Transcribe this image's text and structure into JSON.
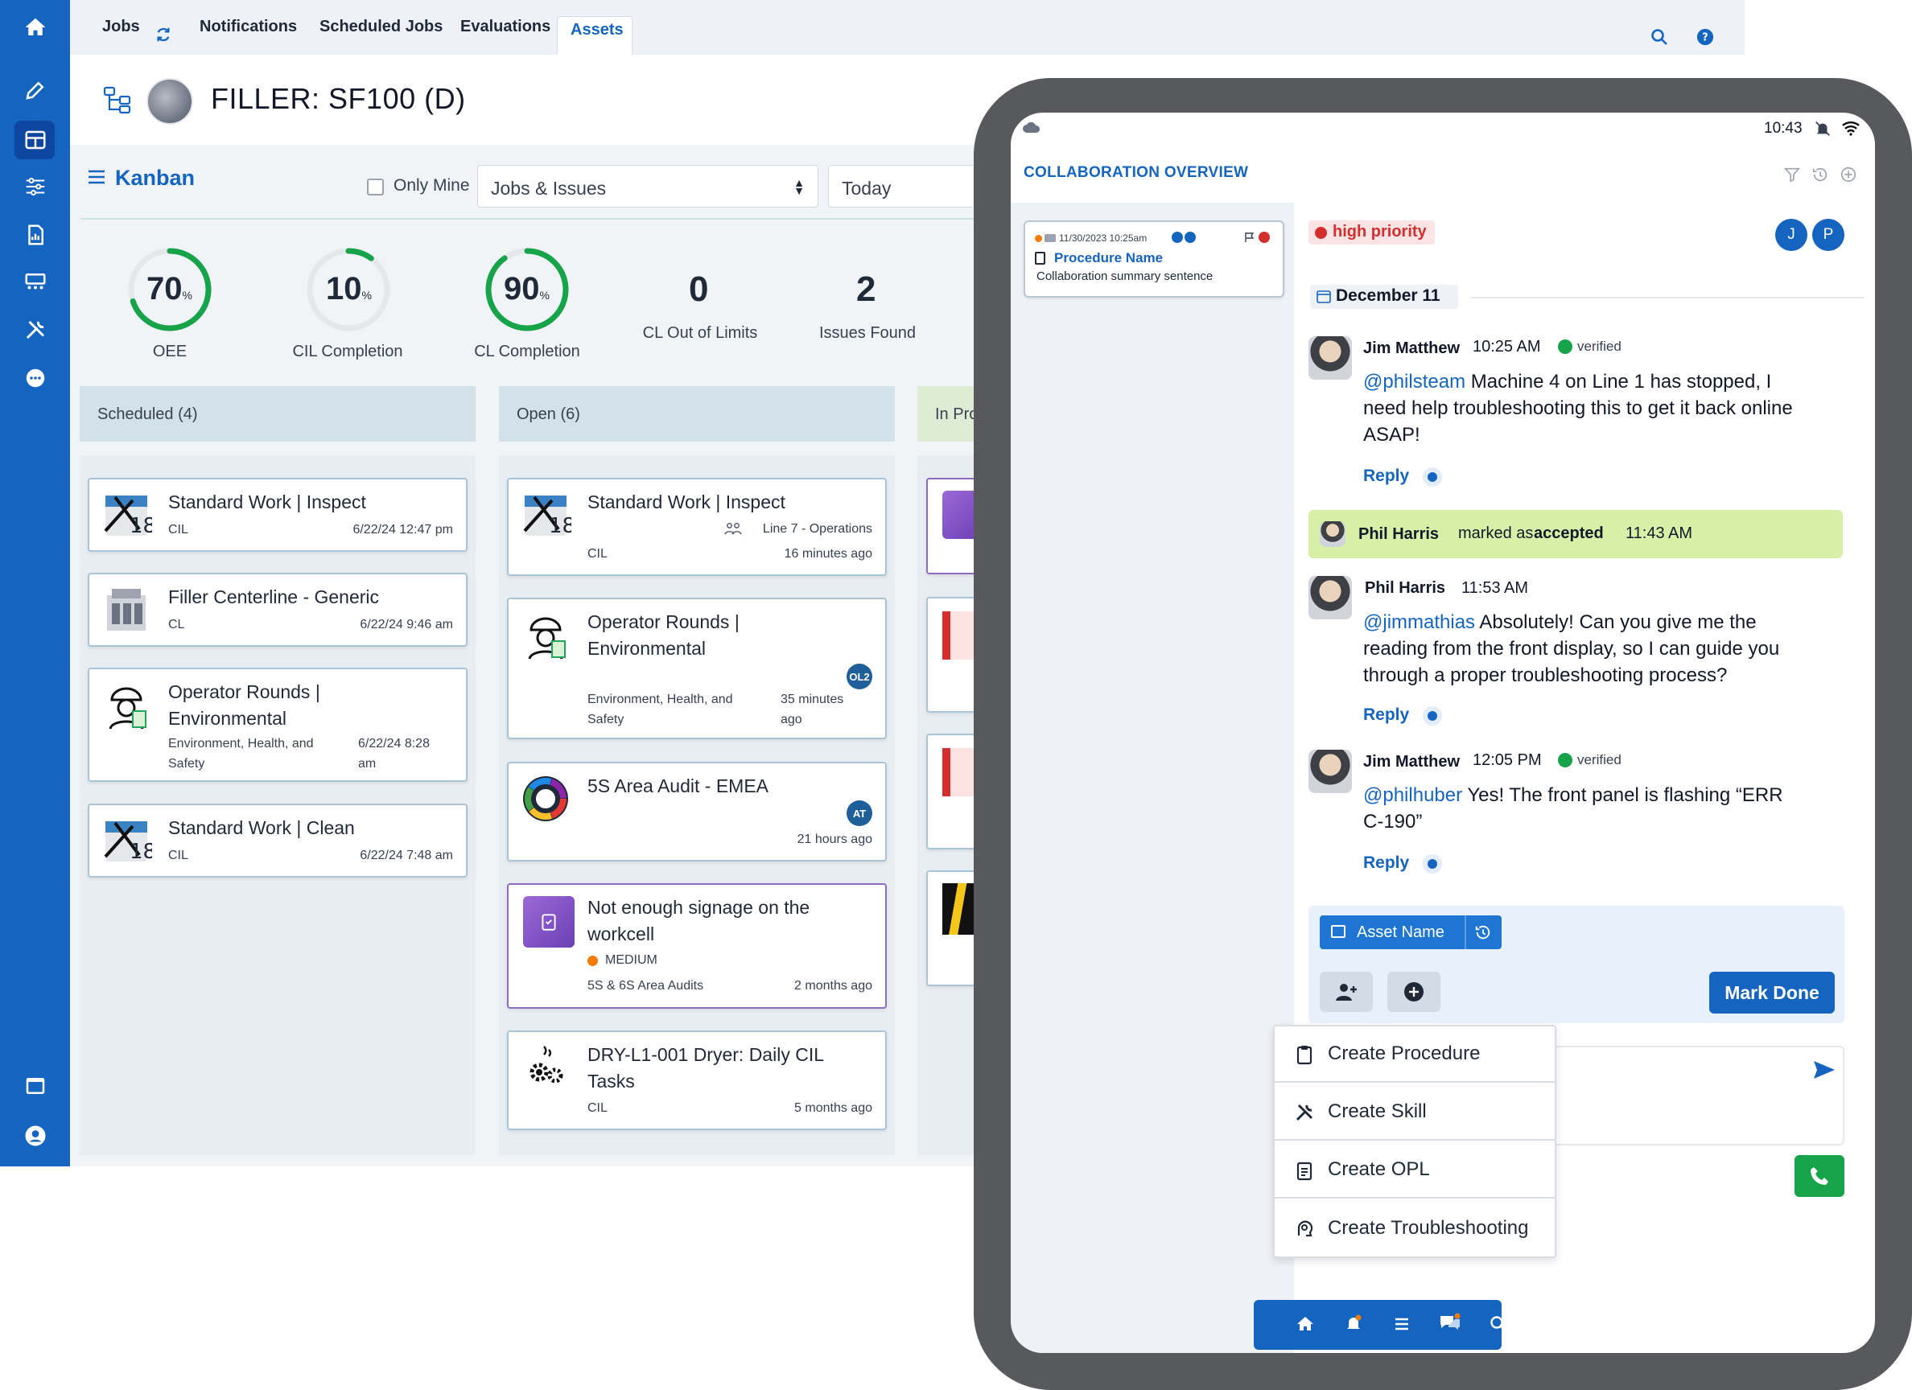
{
  "nav": {
    "tabs": [
      {
        "label": "Jobs"
      },
      {
        "label": "Notifications"
      },
      {
        "label": "Scheduled Jobs"
      },
      {
        "label": "Evaluations"
      },
      {
        "label": "Assets"
      }
    ],
    "active_tab": "Assets"
  },
  "asset": {
    "title": "FILLER: SF100 (D)"
  },
  "toolbar": {
    "view_label": "Kanban",
    "only_mine_label": "Only Mine",
    "filter_value": "Jobs & Issues",
    "date_value": "Today"
  },
  "metrics": [
    {
      "value": "70",
      "unit": "%",
      "label": "OEE",
      "percent": 70
    },
    {
      "value": "10",
      "unit": "%",
      "label": "CIL Completion",
      "percent": 10
    },
    {
      "value": "90",
      "unit": "%",
      "label": "CL Completion",
      "percent": 90
    },
    {
      "value": "0",
      "label": "CL Out of Limits"
    },
    {
      "value": "2",
      "label": "Issues Found"
    }
  ],
  "columns": {
    "scheduled": {
      "header": "Scheduled (4)",
      "cards": [
        {
          "title": "Standard Work | Inspect",
          "type": "CIL",
          "time": "6/22/24 12:47 pm"
        },
        {
          "title": "Filler Centerline - Generic",
          "type": "CL",
          "time": "6/22/24 9:46 am"
        },
        {
          "title_1": "Operator Rounds |",
          "title_2": "Environmental",
          "type_1": "Environment, Health, and",
          "type_2": "Safety",
          "time_1": "6/22/24 8:28",
          "time_2": "am"
        },
        {
          "title": "Standard Work | Clean",
          "type": "CIL",
          "time": "6/22/24 7:48 am"
        }
      ]
    },
    "open": {
      "header": "Open (6)",
      "cards": [
        {
          "title": "Standard Work | Inspect",
          "location": "Line 7 - Operations",
          "type": "CIL",
          "time": "16 minutes ago"
        },
        {
          "title_1": "Operator Rounds |",
          "title_2": "Environmental",
          "badge": "OL2",
          "type_1": "Environment, Health, and",
          "type_2": "Safety",
          "time_1": "35 minutes",
          "time_2": "ago"
        },
        {
          "title": "5S Area Audit - EMEA",
          "badge": "AT",
          "time": "21 hours ago"
        },
        {
          "title_1": "Not enough signage on the",
          "title_2": "workcell",
          "priority": "MEDIUM",
          "type": "5S & 6S Area Audits",
          "time": "2 months ago"
        },
        {
          "title_1": "DRY-L1-001 Dryer: Daily CIL",
          "title_2": "Tasks",
          "type": "CIL",
          "time": "5 months ago"
        }
      ]
    },
    "in_progress": {
      "header": "In Pro"
    }
  },
  "tablet": {
    "status_time": "10:43",
    "header_title": "COLLABORATION OVERVIEW",
    "summary_card": {
      "timestamp": "11/30/2023 10:25am",
      "procedure": "Procedure Name",
      "summary": "Collaboration summary sentence"
    },
    "priority_tag": "high priority",
    "participants": [
      "J",
      "P"
    ],
    "date_divider": "December 11",
    "messages": [
      {
        "author": "Jim Matthew",
        "time": "10:25 AM",
        "verified": "verified",
        "mention": "@philsteam",
        "text_1": " Machine 4 on Line 1 has stopped, I",
        "text_2": "need help troubleshooting this to get it back online",
        "text_3": "ASAP!",
        "reply": "Reply"
      },
      {
        "author": "Phil Harris",
        "time": "11:53 AM",
        "mention": "@jimmathias",
        "text_1": " Absolutely! Can you give me the",
        "text_2": "reading from the front display, so I can guide you",
        "text_3": "through a proper troubleshooting process?",
        "reply": "Reply"
      },
      {
        "author": "Jim Matthew",
        "time": "12:05 PM",
        "verified": "verified",
        "mention": "@philhuber",
        "text_1": " Yes! The front panel is flashing “ERR",
        "text_2": "C-190”",
        "reply": "Reply"
      }
    ],
    "status_event": {
      "author": "Phil Harris",
      "prefix": "marked as",
      "status": "accepted",
      "time": "11:43 AM"
    },
    "asset_chip": "Asset Name",
    "mark_done": "Mark Done",
    "create_menu": [
      "Create Procedure",
      "Create Skill",
      "Create OPL",
      "Create Troubleshooting"
    ]
  },
  "colors": {
    "brand": "#1565c0",
    "gauge_green": "#16a34a",
    "accepted_bg": "#d7f0a8",
    "high_priority": "#d32f2f",
    "medium": "#f57c00"
  }
}
